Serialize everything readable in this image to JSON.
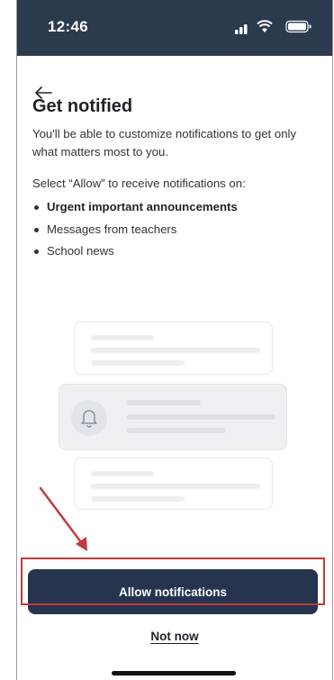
{
  "status_bar": {
    "time": "12:46",
    "icons": [
      "signal-icon",
      "wifi-icon",
      "battery-icon"
    ],
    "background": "#2c3a4e"
  },
  "header": {
    "back_icon": "back-arrow-icon"
  },
  "content": {
    "title": "Get notified",
    "description": "You'll be able to customize notifications to get only what matters most to you.",
    "select_prompt": "Select “Allow” to receive notifications on:",
    "bullets": [
      "Urgent important announcements",
      "Messages from teachers",
      "School news"
    ]
  },
  "illustration": {
    "icon": "bell-icon"
  },
  "actions": {
    "allow_label": "Allow notifications",
    "not_now_label": "Not now",
    "allow_color": "#26344d",
    "highlight_color": "#c23b3b"
  }
}
